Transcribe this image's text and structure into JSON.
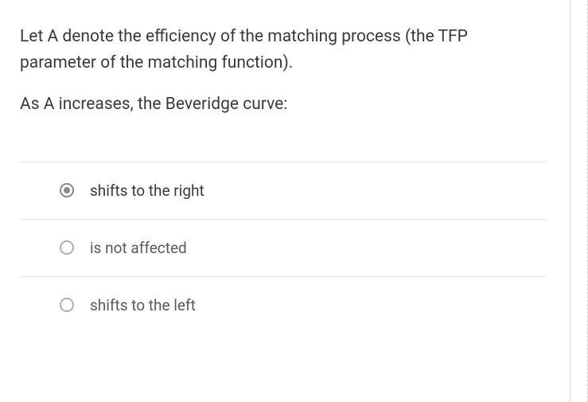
{
  "question": {
    "line1": "Let A denote the efficiency of the matching process (the TFP parameter of the matching function).",
    "line2": "As A increases, the Beveridge curve:"
  },
  "options": [
    {
      "label": "shifts to the right",
      "selected": true
    },
    {
      "label": "is not affected",
      "selected": false
    },
    {
      "label": "shifts to the left",
      "selected": false
    }
  ]
}
